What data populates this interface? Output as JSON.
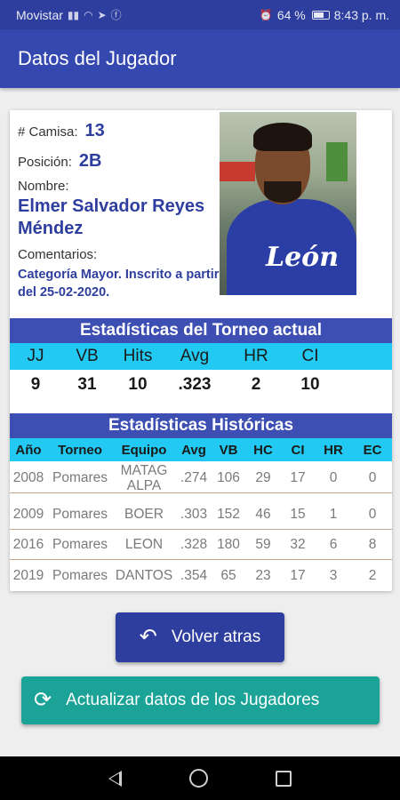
{
  "status_bar": {
    "carrier": "Movistar",
    "signal_icon": "signal-icon",
    "wifi_icon": "wifi-icon",
    "battery_percent": "64 %",
    "time": "8:43 p. m."
  },
  "app_bar": {
    "title": "Datos del Jugador"
  },
  "player": {
    "jersey_label": "# Camisa:",
    "jersey_number": "13",
    "position_label": "Posición:",
    "position": "2B",
    "name_label": "Nombre:",
    "name": "Elmer Salvador Reyes Méndez",
    "comments_label": "Comentarios:",
    "comments": "Categoría Mayor. Inscrito a partir del 25-02-2020."
  },
  "current_stats": {
    "title": "Estadísticas del Torneo actual",
    "headers": [
      "JJ",
      "VB",
      "Hits",
      "Avg",
      "HR",
      "CI"
    ],
    "values": [
      "9",
      "31",
      "10",
      ".323",
      "2",
      "10"
    ]
  },
  "historic_stats": {
    "title": "Estadísticas Históricas",
    "headers": [
      "Año",
      "Torneo",
      "Equipo",
      "Avg",
      "VB",
      "HC",
      "CI",
      "HR",
      "EC"
    ],
    "rows": [
      [
        "2008",
        "Pomares",
        "MATAG ALPA",
        ".274",
        "106",
        "29",
        "17",
        "0",
        "0"
      ],
      [
        "2009",
        "Pomares",
        "BOER",
        ".303",
        "152",
        "46",
        "15",
        "1",
        "0"
      ],
      [
        "2016",
        "Pomares",
        "LEON",
        ".328",
        "180",
        "59",
        "32",
        "6",
        "8"
      ],
      [
        "2019",
        "Pomares",
        "DANTOS",
        ".354",
        "65",
        "23",
        "17",
        "3",
        "2"
      ]
    ]
  },
  "buttons": {
    "back_label": "Volver atras",
    "update_label": "Actualizar datos de los Jugadores"
  },
  "colors": {
    "primary": "#3548b0",
    "accent_cyan": "#22c9f2",
    "teal_button": "#1aa396"
  }
}
